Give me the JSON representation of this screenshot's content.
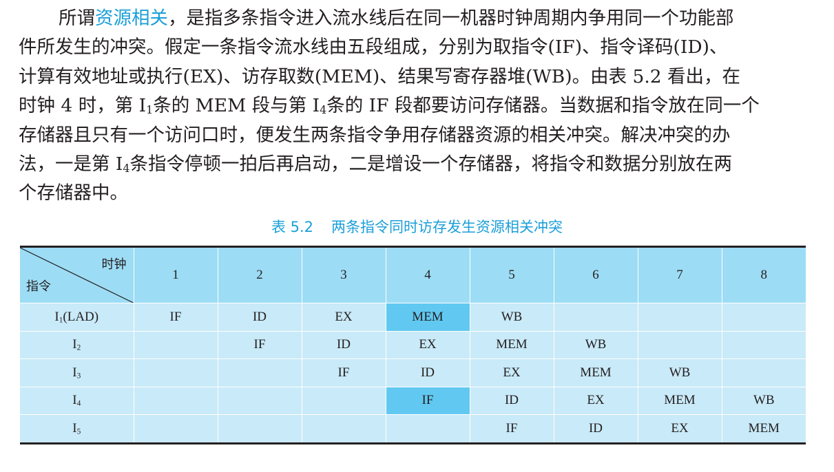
{
  "paragraph": {
    "l1_pre": "所谓",
    "l1_term": "资源相关",
    "l1_post": "，是指多条指令进入流水线后在同一机器时钟周期内争用同一个功能部",
    "l2": "件所发生的冲突。假定一条指令流水线由五段组成，分别为取指令(IF)、指令译码(ID)、",
    "l3": "计算有效地址或执行(EX)、访存取数(MEM)、结果写寄存器堆(WB)。由表 5.2 看出，在",
    "l4_a": "时钟 4 时，第 I",
    "l4_sub1": "1",
    "l4_b": "条的 MEM 段与第 I",
    "l4_sub2": "4",
    "l4_c": "条的 IF 段都要访问存储器。当数据和指令放在同一个",
    "l5": "存储器且只有一个访问口时，便发生两条指令争用存储器资源的相关冲突。解决冲突的办",
    "l6_a": "法，一是第 I",
    "l6_sub": "4",
    "l6_b": "条指令停顿一拍后再启动，二是增设一个存储器，将指令和数据分别放在两",
    "l7": "个存储器中。"
  },
  "caption": {
    "number": "表 5.2",
    "title": "两条指令同时访存发生资源相关冲突"
  },
  "table": {
    "corner_clock": "时钟",
    "corner_instr": "指令",
    "clocks": [
      "1",
      "2",
      "3",
      "4",
      "5",
      "6",
      "7",
      "8"
    ],
    "rows": [
      {
        "label": "I",
        "sub": "1",
        "suffix": "(LAD)",
        "cells": [
          "IF",
          "ID",
          "EX",
          "MEM",
          "WB",
          "",
          "",
          ""
        ],
        "highlight": [
          3
        ]
      },
      {
        "label": "I",
        "sub": "2",
        "suffix": "",
        "cells": [
          "",
          "IF",
          "ID",
          "EX",
          "MEM",
          "WB",
          "",
          ""
        ],
        "highlight": []
      },
      {
        "label": "I",
        "sub": "3",
        "suffix": "",
        "cells": [
          "",
          "",
          "IF",
          "ID",
          "EX",
          "MEM",
          "WB",
          ""
        ],
        "highlight": []
      },
      {
        "label": "I",
        "sub": "4",
        "suffix": "",
        "cells": [
          "",
          "",
          "",
          "IF",
          "ID",
          "EX",
          "MEM",
          "WB"
        ],
        "highlight": [
          3
        ]
      },
      {
        "label": "I",
        "sub": "5",
        "suffix": "",
        "cells": [
          "",
          "",
          "",
          "",
          "IF",
          "ID",
          "EX",
          "MEM"
        ],
        "highlight": []
      }
    ],
    "colors": {
      "header_bg": "#9ddcf5",
      "cell_bg": "#c9eaf8",
      "highlight_bg": "#61c9f1"
    }
  }
}
